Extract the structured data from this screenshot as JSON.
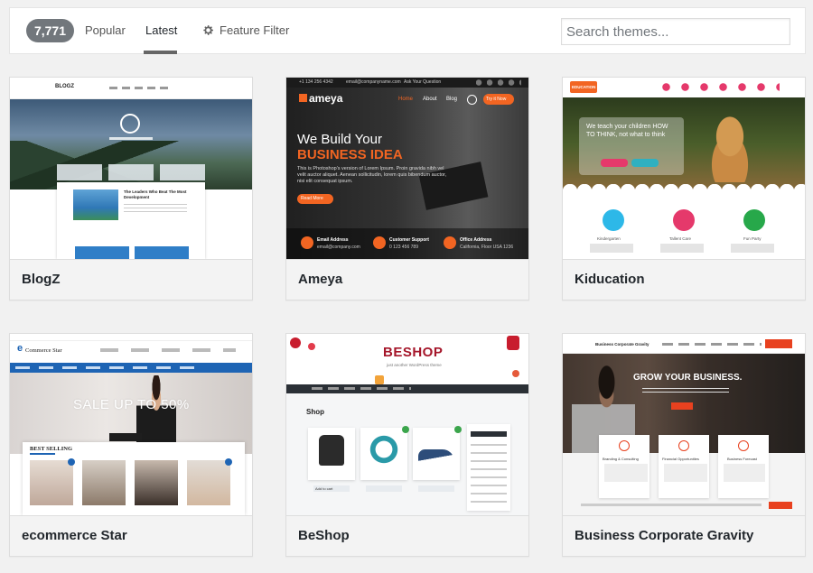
{
  "filter_bar": {
    "count": "7,771",
    "popular": "Popular",
    "latest": "Latest",
    "feature_filter": "Feature Filter",
    "search_placeholder": "Search themes..."
  },
  "themes": [
    {
      "name": "BlogZ",
      "preview": {
        "logo": "BLOGZ",
        "post_title": "The Leaders Who Beat The Most Development"
      }
    },
    {
      "name": "Ameya",
      "preview": {
        "phone": "+1 134 256 4342",
        "email": "email@companyname.com",
        "ask": "Ask Your Question",
        "logo": "ameya",
        "menu": [
          "Home",
          "About",
          "Blog"
        ],
        "cta": "Try it Now",
        "headline_1": "We Build Your",
        "headline_2": "BUSINESS IDEA",
        "body": "This is Photoshop's version of Lorem Ipsum. Proin gravida nibh vel velit auctor aliquet. Aenean sollicitudin, lorem quis bibendum auctor, nisi elit consequat ipsum.",
        "read_more": "Read More",
        "email_label": "Email Address",
        "email_value": "email@company.com",
        "support_label": "Customer Support",
        "support_value": "0 123 456 789",
        "office_label": "Office Address",
        "office_value": "California, Floor USA 1236"
      }
    },
    {
      "name": "Kiducation",
      "preview": {
        "logo": "EDUCATION",
        "headline": "We teach your children HOW TO THINK, not what to think",
        "btn_1": "",
        "btn_2": "",
        "features": [
          "Kindergarten",
          "Tallent Care",
          "Fun Party"
        ]
      }
    },
    {
      "name": "ecommerce Star",
      "preview": {
        "logo_e": "e",
        "logo_text": "Commerce Star",
        "sale": "SALE UP TO 50%",
        "best_selling": "BEST SELLING"
      }
    },
    {
      "name": "BeShop",
      "preview": {
        "logo": "BESHOP",
        "tagline": "just another WordPress theme",
        "section": "Shop",
        "add_to_cart": "Add to cart"
      }
    },
    {
      "name": "Business Corporate Gravity",
      "preview": {
        "logo": "Business Corporate Gravity",
        "headline": "GROW YOUR BUSINESS.",
        "features": [
          "Branding & Consulting",
          "Financial Opportunities",
          "Business Forecast"
        ]
      }
    }
  ],
  "colors": {
    "badge": "#72777c",
    "ameya_orange": "#f26522",
    "kid_red": "#e5396b",
    "estar_blue": "#1e64b4"
  }
}
